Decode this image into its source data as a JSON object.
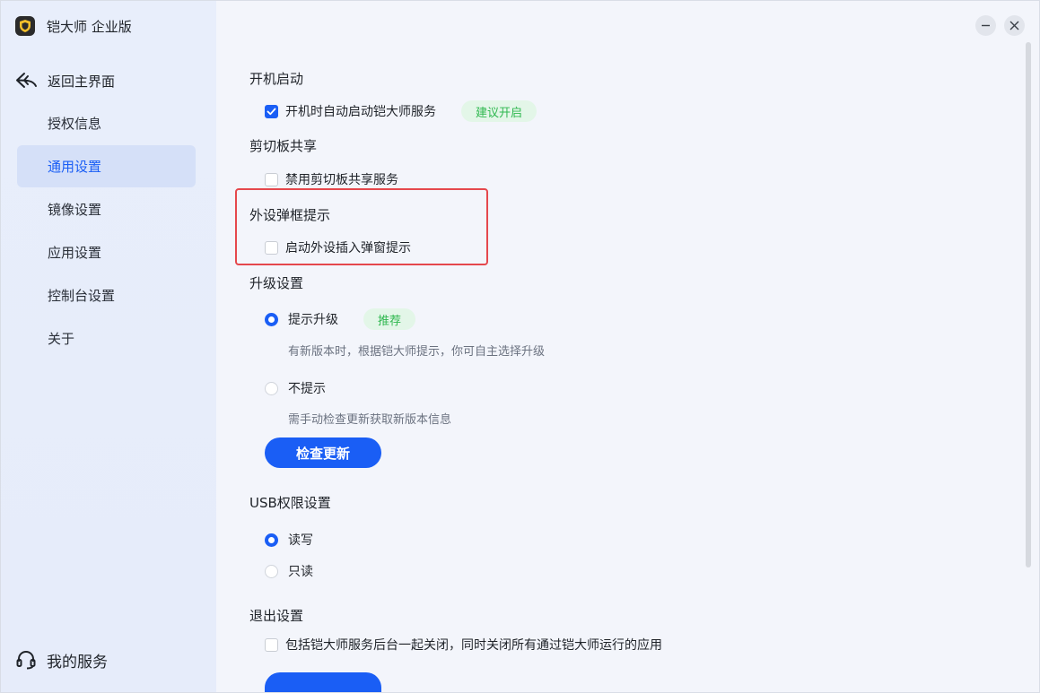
{
  "app": {
    "title": "铠大师 企业版"
  },
  "sidebar": {
    "back_label": "返回主界面",
    "items": [
      {
        "label": "授权信息",
        "active": false
      },
      {
        "label": "通用设置",
        "active": true
      },
      {
        "label": "镜像设置",
        "active": false
      },
      {
        "label": "应用设置",
        "active": false
      },
      {
        "label": "控制台设置",
        "active": false
      },
      {
        "label": "关于",
        "active": false
      }
    ],
    "service_label": "我的服务"
  },
  "settings": {
    "startup": {
      "title": "开机启动",
      "option_label": "开机时自动启动铠大师服务",
      "checked": true,
      "badge": "建议开启"
    },
    "clipboard": {
      "title": "剪切板共享",
      "option_label": "禁用剪切板共享服务",
      "checked": false
    },
    "peripheral": {
      "title": "外设弹框提示",
      "option_label": "启动外设插入弹窗提示",
      "checked": false
    },
    "upgrade": {
      "title": "升级设置",
      "option1_label": "提示升级",
      "option1_badge": "推荐",
      "option1_hint": "有新版本时，根据铠大师提示，你可自主选择升级",
      "option2_label": "不提示",
      "option2_hint": "需手动检查更新获取新版本信息",
      "selected": "option1",
      "check_button": "检查更新"
    },
    "usb": {
      "title": "USB权限设置",
      "option1_label": "读写",
      "option2_label": "只读",
      "selected": "option1"
    },
    "exit": {
      "title": "退出设置",
      "option_label": "包括铠大师服务后台一起关闭，同时关闭所有通过铠大师运行的应用",
      "checked": false
    }
  },
  "colors": {
    "accent": "#1a5ef5",
    "badge_bg": "#e3f6e8",
    "badge_text": "#2fb84f",
    "highlight": "#e5484d"
  }
}
